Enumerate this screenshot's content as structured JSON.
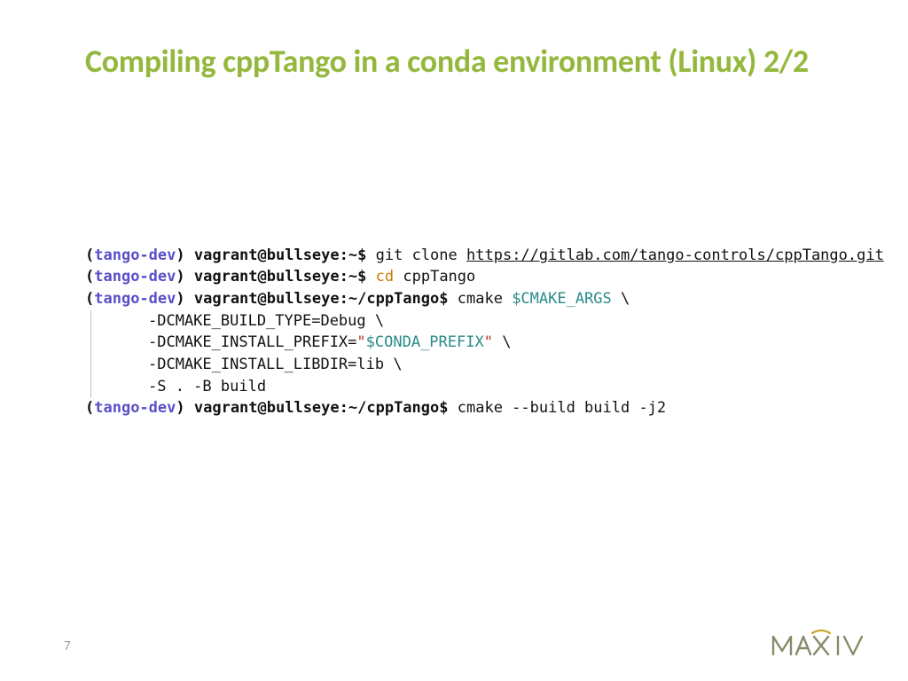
{
  "title": "Compiling cppTango in a conda environment (Linux) 2/2",
  "page_number": "7",
  "logo_text": "MAX IV",
  "terminal": {
    "env_label": "tango-dev",
    "lines": [
      {
        "prompt_host": "vagrant@bullseye",
        "prompt_path": "~",
        "cmd": "git clone",
        "cmd_type": "git",
        "url": "https://gitlab.com/tango-controls/cppTango.git"
      },
      {
        "prompt_host": "vagrant@bullseye",
        "prompt_path": "~",
        "cmd": "cd",
        "cmd_type": "cd",
        "args": "cppTango"
      },
      {
        "prompt_host": "vagrant@bullseye",
        "prompt_path": "~/cppTango",
        "cmd": "cmake",
        "cmd_type": "plain",
        "var": "$CMAKE_ARGS",
        "tail": " \\"
      },
      {
        "indent": true,
        "text": "-DCMAKE_BUILD_TYPE=Debug \\"
      },
      {
        "indent": true,
        "prefix": "-DCMAKE_INSTALL_PREFIX=",
        "quote_open": "\"",
        "var": "$CONDA_PREFIX",
        "quote_close": "\"",
        "tail": " \\"
      },
      {
        "indent": true,
        "text": "-DCMAKE_INSTALL_LIBDIR=lib \\"
      },
      {
        "indent": true,
        "text": "-S . -B build"
      },
      {
        "prompt_host": "vagrant@bullseye",
        "prompt_path": "~/cppTango",
        "cmd": "cmake --build build -j2",
        "cmd_type": "plain"
      }
    ]
  }
}
